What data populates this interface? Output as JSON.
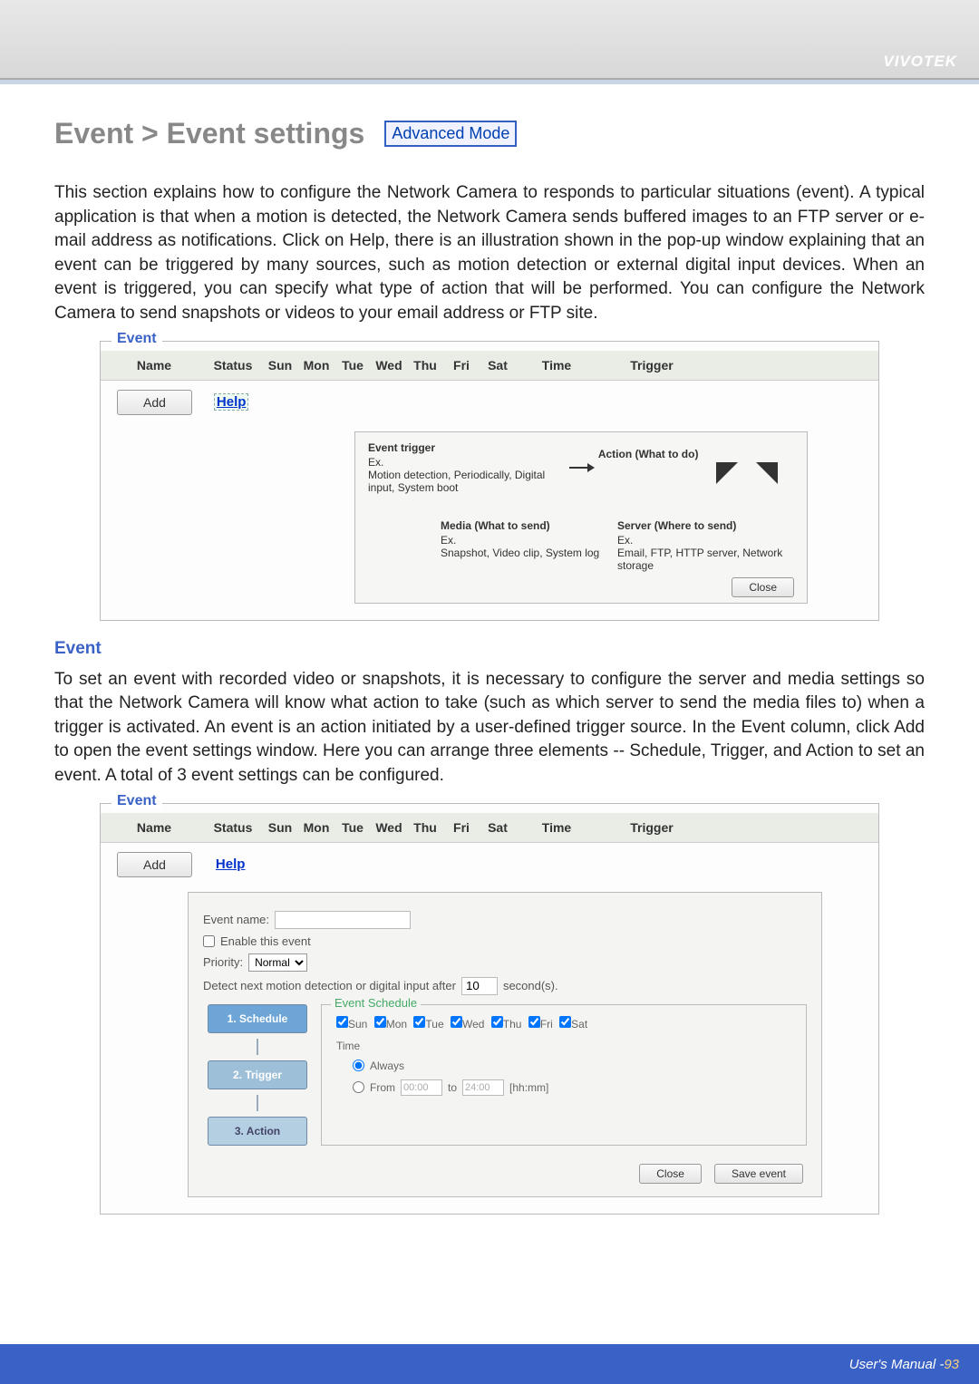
{
  "brand": "VIVOTEK",
  "page": {
    "title": "Event > Event settings",
    "mode_badge": "Advanced Mode"
  },
  "intro_paragraph": "This section explains how to configure the Network Camera to responds to particular situations (event). A typical application is that when a motion is detected, the Network Camera sends buffered images to an FTP server or e-mail address as notifications. Click on Help, there is an illustration shown in the pop-up window explaining that an event can be triggered by many sources, such as motion detection or external digital input devices. When an event is triggered, you can specify what type of action that will be performed. You can configure the Network Camera to send snapshots or videos to your email address or FTP site.",
  "event_panel": {
    "legend": "Event",
    "columns": [
      "Name",
      "Status",
      "Sun",
      "Mon",
      "Tue",
      "Wed",
      "Thu",
      "Fri",
      "Sat",
      "Time",
      "Trigger"
    ],
    "add_label": "Add",
    "help_label": "Help"
  },
  "help_diagram": {
    "trigger_title": "Event trigger",
    "trigger_ex_label": "Ex.",
    "trigger_ex": "Motion detection, Periodically, Digital input, System boot",
    "action_title": "Action (What to do)",
    "media_title": "Media (What to send)",
    "media_ex_label": "Ex.",
    "media_ex": "Snapshot, Video clip, System log",
    "server_title": "Server (Where to send)",
    "server_ex_label": "Ex.",
    "server_ex": "Email, FTP, HTTP server, Network storage",
    "close_label": "Close"
  },
  "event_section_title": "Event",
  "event_body_paragraph": "To set an event with recorded video or snapshots, it is necessary to configure the server and media settings so that the Network Camera will know what action to take (such as which server to send the media files to) when a trigger is activated. An event is an action initiated by a user-defined trigger source. In the Event column, click Add to open the event settings window. Here you can arrange three elements -- Schedule, Trigger, and Action to set an event. A total of 3 event settings can be configured.",
  "event_form": {
    "name_label": "Event name:",
    "enable_label": "Enable this event",
    "priority_label": "Priority:",
    "priority_value": "Normal",
    "detect_label_prefix": "Detect next motion detection or digital input after",
    "detect_value": "10",
    "detect_label_suffix": "second(s).",
    "steps": {
      "s1": "1. Schedule",
      "s2": "2. Trigger",
      "s3": "3. Action"
    },
    "schedule": {
      "legend": "Event Schedule",
      "days": [
        "Sun",
        "Mon",
        "Tue",
        "Wed",
        "Thu",
        "Fri",
        "Sat"
      ],
      "time_label": "Time",
      "always_label": "Always",
      "from_label": "From",
      "from_value": "00:00",
      "to_label": "to",
      "to_value": "24:00",
      "hhmm": "[hh:mm]"
    },
    "close_label": "Close",
    "save_label": "Save event"
  },
  "footer": {
    "label": "User's Manual - ",
    "page_number": "93"
  }
}
